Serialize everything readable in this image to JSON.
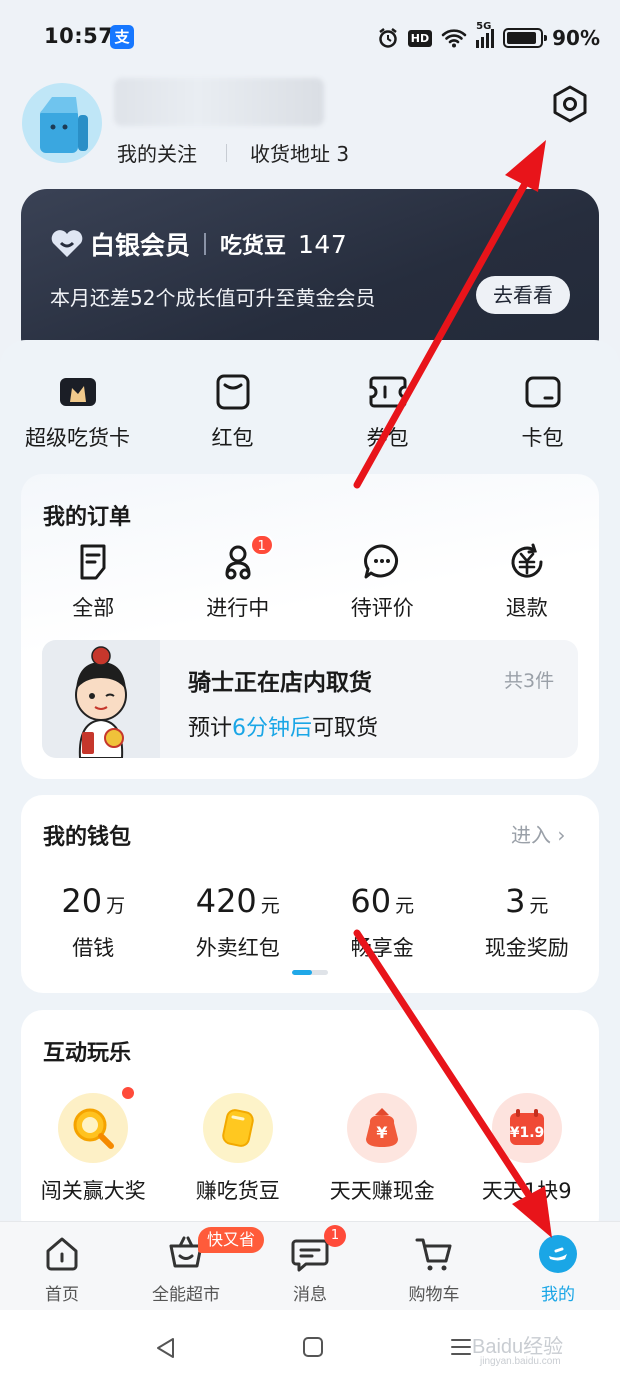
{
  "status_bar": {
    "time": "10:57",
    "app_badge": "支",
    "hd": "HD",
    "network": "5G",
    "battery": "90%",
    "battery_level": 0.9
  },
  "profile": {
    "follow_label": "我的关注",
    "address_label": "收货地址 3",
    "settings_icon": "hexagon-settings-icon"
  },
  "member": {
    "tier": "白银会员",
    "beans_label": "吃货豆",
    "beans_count": "147",
    "desc": "本月还差52个成长值可升至黄金会员",
    "button": "去看看"
  },
  "quick_links": [
    {
      "label": "超级吃货卡",
      "icon": "crown-card-icon"
    },
    {
      "label": "红包",
      "icon": "red-packet-icon"
    },
    {
      "label": "券包",
      "icon": "coupon-icon"
    },
    {
      "label": "卡包",
      "icon": "card-wallet-icon"
    }
  ],
  "orders": {
    "title": "我的订单",
    "items": [
      {
        "label": "全部",
        "icon": "order-list-icon"
      },
      {
        "label": "进行中",
        "icon": "rider-icon",
        "badge": "1"
      },
      {
        "label": "待评价",
        "icon": "comment-icon"
      },
      {
        "label": "退款",
        "icon": "refund-icon"
      }
    ],
    "delivery": {
      "title": "骑士正在店内取货",
      "count": "共3件",
      "eta_prefix": "预计",
      "eta_highlight": "6分钟后",
      "eta_suffix": "可取货"
    }
  },
  "wallet": {
    "title": "我的钱包",
    "enter": "进入 ›",
    "items": [
      {
        "value": "20",
        "unit": "万",
        "label": "借钱"
      },
      {
        "value": "420",
        "unit": "元",
        "label": "外卖红包"
      },
      {
        "value": "60",
        "unit": "元",
        "label": "畅享金"
      },
      {
        "value": "3",
        "unit": "元",
        "label": "现金奖励"
      }
    ]
  },
  "fun": {
    "title": "互动玩乐",
    "items": [
      {
        "label": "闯关赢大奖",
        "icon": "magnifier-game-icon",
        "dot": true
      },
      {
        "label": "赚吃货豆",
        "icon": "bean-icon",
        "dot": false
      },
      {
        "label": "天天赚现金",
        "icon": "money-bag-icon",
        "dot": false
      },
      {
        "label": "天天1块9",
        "icon": "calendar-deal-icon",
        "dot": false
      }
    ]
  },
  "tabbar": {
    "items": [
      {
        "label": "首页",
        "icon": "home-icon"
      },
      {
        "label": "全能超市",
        "icon": "basket-icon",
        "promo": "快又省"
      },
      {
        "label": "消息",
        "icon": "message-icon",
        "badge": "1"
      },
      {
        "label": "购物车",
        "icon": "cart-icon"
      },
      {
        "label": "我的",
        "icon": "profile-active-icon",
        "active": true
      }
    ]
  },
  "watermark": {
    "main": "Baidu经验",
    "sub": "jingyan.baidu.com"
  },
  "colors": {
    "accent": "#1aa6e6",
    "badge": "#ff4b3a",
    "card_dark": "#262d3d",
    "arrow": "#e8141a"
  }
}
